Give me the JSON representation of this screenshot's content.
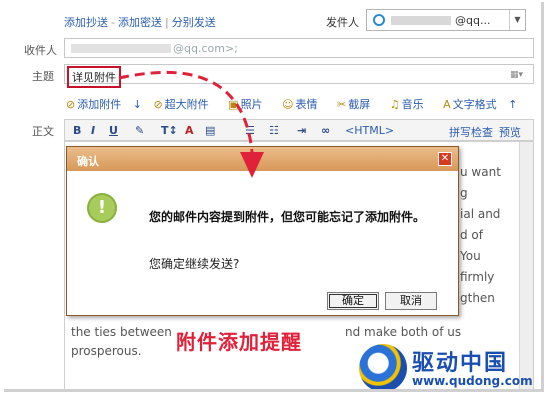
{
  "header": {
    "links": [
      "添加抄送",
      "添加密送",
      "分别发送"
    ],
    "sender_label": "发件人",
    "sender_value": "@qq..."
  },
  "recipient": {
    "label": "收件人",
    "value": "@qq.com>;"
  },
  "subject": {
    "label": "主题",
    "value": "详见附件"
  },
  "attach_bar": {
    "add_attachment": "添加附件",
    "big_attachment": "超大附件",
    "photo": "照片",
    "emoticon": "表情",
    "screenshot": "截屏",
    "music": "音乐",
    "text_format": "文字格式"
  },
  "editor": {
    "body_label": "正文",
    "toolbar": {
      "bold": "B",
      "italic": "I",
      "underline": "U",
      "html": "<HTML>",
      "spellcheck": "拼写检查",
      "preview": "预览"
    },
    "right_fragments": [
      "u want",
      "g",
      "ial and",
      "d of",
      "You",
      "firmly",
      "gthen"
    ],
    "bottom_lines": [
      "the ties between",
      "nd make both of us",
      "prosperous."
    ]
  },
  "dialog": {
    "title": "确认",
    "close_symbol": "✕",
    "icon": "!",
    "message": "您的邮件内容提到附件，但您可能忘记了添加附件。",
    "question": "您确定继续发送?",
    "ok_label": "确定",
    "cancel_label": "取消"
  },
  "annotation": {
    "text": "附件添加提醒",
    "color": "#e0213a"
  },
  "watermark": {
    "name": "驱动中国",
    "url": "www.qudong.com"
  }
}
